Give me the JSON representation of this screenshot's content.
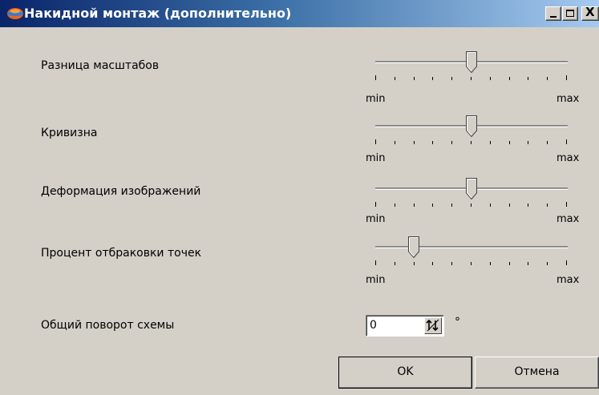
{
  "window": {
    "title": "Накидной монтаж (дополнительно)",
    "controls": {
      "minimize_icon": "minimize-icon",
      "maximize_icon": "maximize-icon",
      "close_glyph": "X"
    },
    "app_icon": "mosaic-app-icon"
  },
  "colors": {
    "titlebar_start": "#0a246a",
    "titlebar_end": "#a6caf0",
    "dialog_bg": "#d4d0c8"
  },
  "sliders": [
    {
      "label": "Разница масштабов",
      "min_label": "min",
      "max_label": "max",
      "position": 0.5
    },
    {
      "label": "Кривизна",
      "min_label": "min",
      "max_label": "max",
      "position": 0.5
    },
    {
      "label": "Деформация изображений",
      "min_label": "min",
      "max_label": "max",
      "position": 0.5
    },
    {
      "label": "Процент отбраковки точек",
      "min_label": "min",
      "max_label": "max",
      "position": 0.2
    }
  ],
  "rotation": {
    "label": "Общий поворот схемы",
    "value": "0",
    "unit": "°"
  },
  "buttons": {
    "ok": "OK",
    "cancel": "Отмена"
  }
}
